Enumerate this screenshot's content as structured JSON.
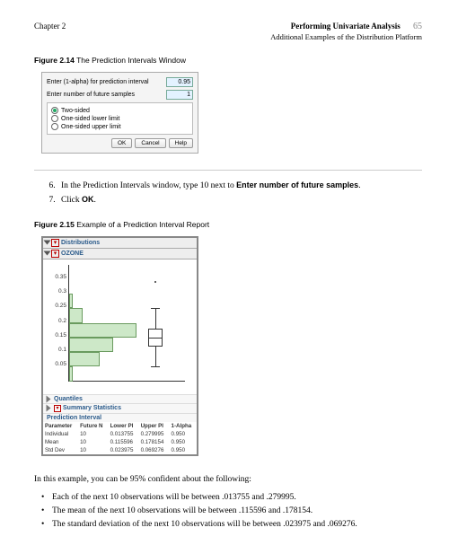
{
  "header": {
    "left": "Chapter 2",
    "chapter_title": "Performing Univariate Analysis",
    "page_number": "65",
    "subtitle": "Additional Examples of the Distribution Platform"
  },
  "figure14": {
    "caption_prefix": "Figure 2.14",
    "caption_text": "The Prediction Intervals Window",
    "label_alpha": "Enter (1-alpha) for prediction interval",
    "value_alpha": "0.95",
    "label_n": "Enter number of future samples",
    "value_n": "1",
    "radio_twosided": "Two-sided",
    "radio_lower": "One-sided lower limit",
    "radio_upper": "One-sided upper limit",
    "btn_ok": "OK",
    "btn_cancel": "Cancel",
    "btn_help": "Help"
  },
  "instructions": {
    "step6_a": "In the Prediction Intervals window, type 10 next to ",
    "step6_b": "Enter number of future samples",
    "step6_c": ".",
    "step7_a": "Click ",
    "step7_b": "OK",
    "step7_c": "."
  },
  "figure15": {
    "caption_prefix": "Figure 2.15",
    "caption_text": "Example of a Prediction Interval Report",
    "dist_title": "Distributions",
    "var_title": "OZONE",
    "quantiles_title": "Quantiles",
    "summary_title": "Summary Statistics",
    "pred_title": "Prediction Interval",
    "table_headers": [
      "Parameter",
      "Future N",
      "Lower PI",
      "Upper PI",
      "1-Alpha"
    ],
    "table_rows": [
      [
        "Individual",
        "10",
        "0.013755",
        "0.279995",
        "0.950"
      ],
      [
        "Mean",
        "10",
        "0.115596",
        "0.178154",
        "0.950"
      ],
      [
        "Std Dev",
        "10",
        "0.023975",
        "0.069276",
        "0.950"
      ]
    ]
  },
  "chart_data": {
    "type": "histogram_with_boxplot",
    "ylabel": "",
    "ylim": [
      0,
      0.4
    ],
    "y_ticks": [
      0.05,
      0.1,
      0.15,
      0.2,
      0.25,
      0.3,
      0.35
    ],
    "bin_width": 0.05,
    "bins": [
      {
        "low": 0.0,
        "high": 0.05,
        "count_rel": 0.05
      },
      {
        "low": 0.05,
        "high": 0.1,
        "count_rel": 0.45
      },
      {
        "low": 0.1,
        "high": 0.15,
        "count_rel": 0.65
      },
      {
        "low": 0.15,
        "high": 0.2,
        "count_rel": 1.0
      },
      {
        "low": 0.2,
        "high": 0.25,
        "count_rel": 0.2
      },
      {
        "low": 0.25,
        "high": 0.3,
        "count_rel": 0.05
      }
    ],
    "boxplot": {
      "min_whisker": 0.05,
      "q1": 0.12,
      "median": 0.15,
      "q3": 0.18,
      "max_whisker": 0.25,
      "outliers": [
        0.34
      ]
    }
  },
  "body": {
    "intro": "In this example, you can be 95% confident about the following:",
    "bullet1": "Each of the next 10 observations will be between .013755 and .279995.",
    "bullet2": "The mean of the next 10 observations will be between .115596 and .178154.",
    "bullet3": "The standard deviation of the next 10 observations will be between .023975 and .069276."
  }
}
